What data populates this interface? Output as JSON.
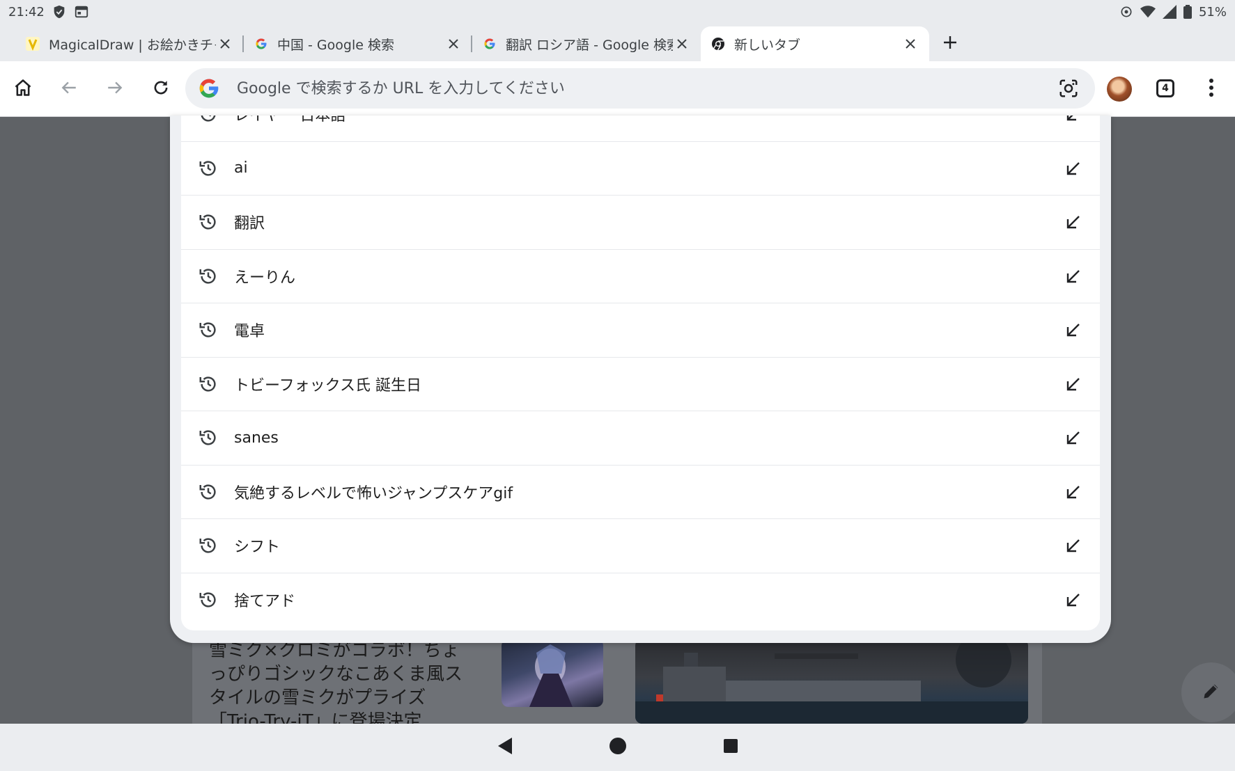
{
  "status_bar": {
    "time": "21:42",
    "battery": "51%"
  },
  "tabs": [
    {
      "title": "MagicalDraw | お絵かきチャ",
      "favicon": "magicaldraw-icon",
      "active": false
    },
    {
      "title": "中国 - Google 検索",
      "favicon": "google-g-icon",
      "active": false
    },
    {
      "title": "翻訳 ロシア語 - Google 検索",
      "favicon": "google-g-icon",
      "active": false
    },
    {
      "title": "新しいタブ",
      "favicon": "chrome-icon",
      "active": true
    }
  ],
  "tab_count": "4",
  "omnibox": {
    "placeholder": "Google で検索するか URL を入力してください"
  },
  "suggestions": [
    {
      "text": "レイヤー 日本語"
    },
    {
      "text": "ai"
    },
    {
      "text": "翻訳"
    },
    {
      "text": "えーりん"
    },
    {
      "text": "電卓"
    },
    {
      "text": "トビーフォックス氏 誕生日"
    },
    {
      "text": "sanes"
    },
    {
      "text": "気絶するレベルで怖いジャンプスケアgif"
    },
    {
      "text": "シフト"
    },
    {
      "text": "捨てアド"
    }
  ],
  "background_article": {
    "text": "雪ミク×クロミがコラボ！ちょっぴりゴシックなこあくま風スタイルの雪ミクがプライズ「Trio-Try-iT」に登場決定"
  },
  "colors": {
    "accent_blue": "#4285f4",
    "accent_red": "#ea4335",
    "accent_yellow": "#fbbc05",
    "accent_green": "#34a853"
  }
}
